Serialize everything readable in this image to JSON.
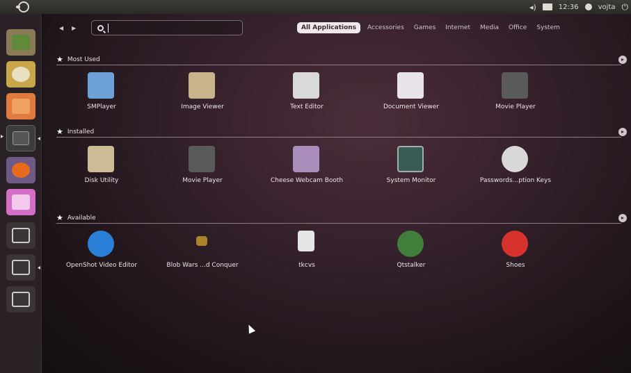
{
  "top_panel": {
    "time": "12:36",
    "user": "vojta"
  },
  "dash": {
    "search_value": "",
    "filters": [
      {
        "label": "All Applications",
        "active": true
      },
      {
        "label": "Accessories",
        "active": false
      },
      {
        "label": "Games",
        "active": false
      },
      {
        "label": "Internet",
        "active": false
      },
      {
        "label": "Media",
        "active": false
      },
      {
        "label": "Office",
        "active": false
      },
      {
        "label": "System",
        "active": false
      }
    ]
  },
  "sections": [
    {
      "title": "Most Used",
      "apps": [
        {
          "label": "SMPlayer",
          "icon": "smplayer-icon",
          "color": "#6ea0d8"
        },
        {
          "label": "Image Viewer",
          "icon": "image-viewer-icon",
          "color": "#c9b38a"
        },
        {
          "label": "Text Editor",
          "icon": "text-editor-icon",
          "color": "#d9d9d9"
        },
        {
          "label": "Document Viewer",
          "icon": "document-viewer-icon",
          "color": "#e8e4ea"
        },
        {
          "label": "Movie Player",
          "icon": "movie-player-icon",
          "color": "#5a5a5a"
        }
      ]
    },
    {
      "title": "Installed",
      "apps": [
        {
          "label": "Disk Utility",
          "icon": "disk-utility-icon",
          "color": "#cdbb96"
        },
        {
          "label": "Movie Player",
          "icon": "movie-player-icon",
          "color": "#5a5a5a"
        },
        {
          "label": "Cheese Webcam Booth",
          "icon": "cheese-webcam-icon",
          "color": "#a98dbb"
        },
        {
          "label": "System Monitor",
          "icon": "system-monitor-icon",
          "color": "#3a5a54"
        },
        {
          "label": "Passwords...ption Keys",
          "icon": "passwords-keys-icon",
          "color": "#d8d8d8"
        }
      ]
    },
    {
      "title": "Available",
      "apps": [
        {
          "label": "OpenShot Video Editor",
          "icon": "openshot-icon",
          "color": "#2a7fd6"
        },
        {
          "label": "Blob Wars ...d Conquer",
          "icon": "blob-wars-icon",
          "color": "#a8842c"
        },
        {
          "label": "tkcvs",
          "icon": "tkcvs-icon",
          "color": "#e6e6e6"
        },
        {
          "label": "Qtstalker",
          "icon": "qtstalker-icon",
          "color": "#3f7f3b"
        },
        {
          "label": "Shoes",
          "icon": "shoes-icon",
          "color": "#d6322b"
        }
      ]
    }
  ],
  "launcher": [
    {
      "icon": "dash-home-icon",
      "color": "#8a7a56"
    },
    {
      "icon": "files-folders-icon",
      "color": "#c9a64a"
    },
    {
      "icon": "photos-icon",
      "color": "#e07a3f"
    },
    {
      "icon": "workspaces-icon",
      "color": "#3c3c3c"
    },
    {
      "icon": "firefox-icon",
      "color": "#e66b1e"
    },
    {
      "icon": "pink-app-icon",
      "color": "#d46fc8"
    },
    {
      "icon": "folder-icon",
      "color": "#3a3437"
    },
    {
      "icon": "applications-icon",
      "color": "#3a3437"
    },
    {
      "icon": "trash-icon",
      "color": "#3a3437"
    }
  ]
}
